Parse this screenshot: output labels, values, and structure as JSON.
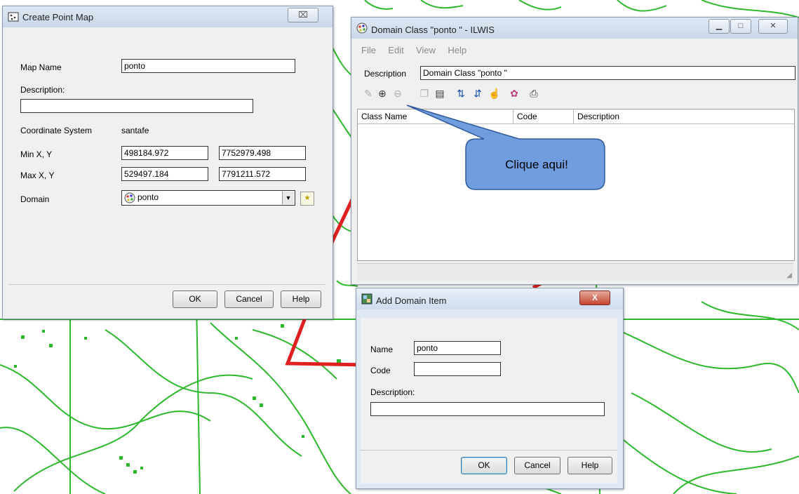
{
  "create_point_map": {
    "title": "Create Point Map",
    "close_label": "⌧",
    "map_name_label": "Map Name",
    "map_name_value": "ponto",
    "description_label": "Description:",
    "description_value": "",
    "coord_system_label": "Coordinate System",
    "coord_system_value": "santafe",
    "min_label": "Min X, Y",
    "min_x": "498184.972",
    "min_y": "7752979.498",
    "max_label": "Max X, Y",
    "max_x": "529497.184",
    "max_y": "7791211.572",
    "domain_label": "Domain",
    "domain_value": "ponto",
    "ok_label": "OK",
    "cancel_label": "Cancel",
    "help_label": "Help"
  },
  "domain_class": {
    "title": "Domain Class \"ponto \" - ILWIS",
    "menu": [
      "File",
      "Edit",
      "View",
      "Help"
    ],
    "description_label": "Description",
    "description_value": "Domain Class \"ponto \"",
    "columns": [
      "Class Name",
      "Code",
      "Description"
    ],
    "toolbar_icons": [
      "edit-icon",
      "add-item-icon",
      "delete-item-icon",
      "copy-icon",
      "paste-icon",
      "sort-ascending-icon",
      "sort-descending-icon",
      "sort-custom-icon",
      "palette-icon",
      "print-icon"
    ]
  },
  "callout": {
    "text": "Clique aqui!",
    "fill": "#6f9de0"
  },
  "add_domain_item": {
    "title": "Add Domain Item",
    "close_label": "X",
    "name_label": "Name",
    "name_value": "ponto",
    "code_label": "Code",
    "code_value": "",
    "description_label": "Description:",
    "description_value": "",
    "ok_label": "OK",
    "cancel_label": "Cancel",
    "help_label": "Help"
  },
  "colors": {
    "map_green": "#2db82d",
    "map_red": "#e02020",
    "window_bg": "#f0f0f0"
  }
}
